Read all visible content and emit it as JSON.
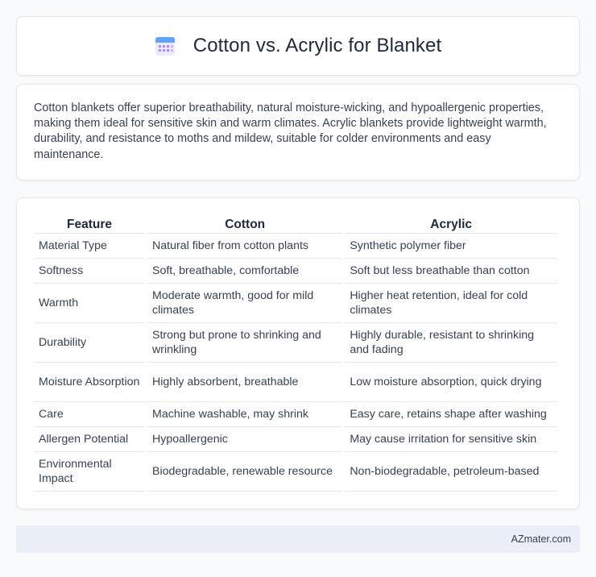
{
  "header": {
    "title": "Cotton vs. Acrylic for Blanket",
    "icon": "calendar-icon"
  },
  "summary": {
    "text": "Cotton blankets offer superior breathability, natural moisture-wicking, and hypoallergenic properties, making them ideal for sensitive skin and warm climates. Acrylic blankets provide lightweight warmth, durability, and resistance to moths and mildew, suitable for colder environments and easy maintenance."
  },
  "table": {
    "headers": [
      "Feature",
      "Cotton",
      "Acrylic"
    ],
    "rows": [
      [
        "Material Type",
        "Natural fiber from cotton plants",
        "Synthetic polymer fiber"
      ],
      [
        "Softness",
        "Soft, breathable, comfortable",
        "Soft but less breathable than cotton"
      ],
      [
        "Warmth",
        "Moderate warmth, good for mild climates",
        "Higher heat retention, ideal for cold climates"
      ],
      [
        "Durability",
        "Strong but prone to shrinking and wrinkling",
        "Highly durable, resistant to shrinking and fading"
      ],
      [
        "Moisture Absorption",
        "Highly absorbent, breathable",
        "Low moisture absorption, quick drying"
      ],
      [
        "Care",
        "Machine washable, may shrink",
        "Easy care, retains shape after washing"
      ],
      [
        "Allergen Potential",
        "Hypoallergenic",
        "May cause irritation for sensitive skin"
      ],
      [
        "Environmental Impact",
        "Biodegradable, renewable resource",
        "Non-biodegradable, petroleum-based"
      ]
    ]
  },
  "footer": {
    "text": "AZmater.com"
  },
  "colors": {
    "background": "#f9fafb",
    "card": "#ffffff",
    "border": "#e5e7eb",
    "footer_bg": "#e9eef7",
    "icon_accent": "#a78bfa"
  }
}
